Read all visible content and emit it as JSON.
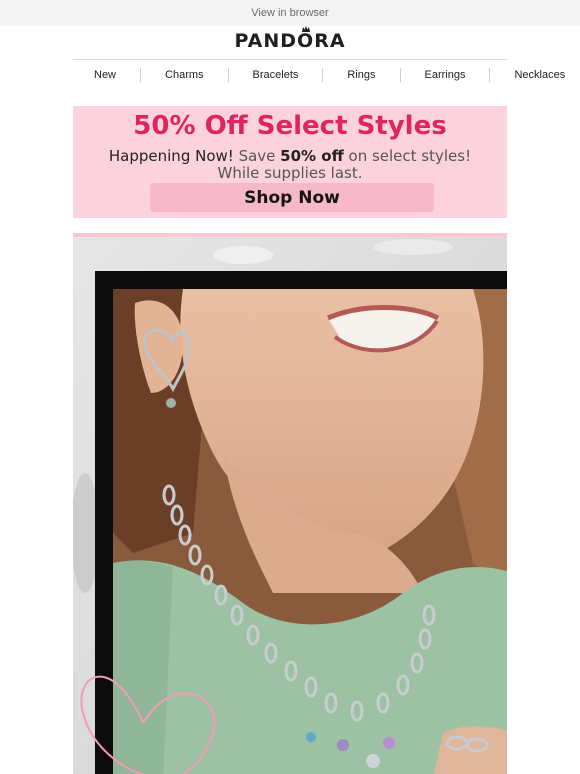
{
  "topbar": {
    "view_in_browser": "View in browser"
  },
  "brand": {
    "logo_prefix": "PAND",
    "logo_o": "O",
    "logo_suffix": "RA"
  },
  "nav": {
    "items": [
      "New",
      "Charms",
      "Bracelets",
      "Rings",
      "Earrings",
      "Necklaces"
    ]
  },
  "promo": {
    "title": "50% Off Select Styles",
    "lead": "Happening Now!",
    "text_a": " Save ",
    "discount": "50% off",
    "text_b": " on select styles! While supplies last.",
    "cta": "Shop Now"
  },
  "colors": {
    "promo_bg": "#fcd3dd",
    "promo_title": "#e0245e",
    "cta_bg": "#f7b9c9"
  }
}
